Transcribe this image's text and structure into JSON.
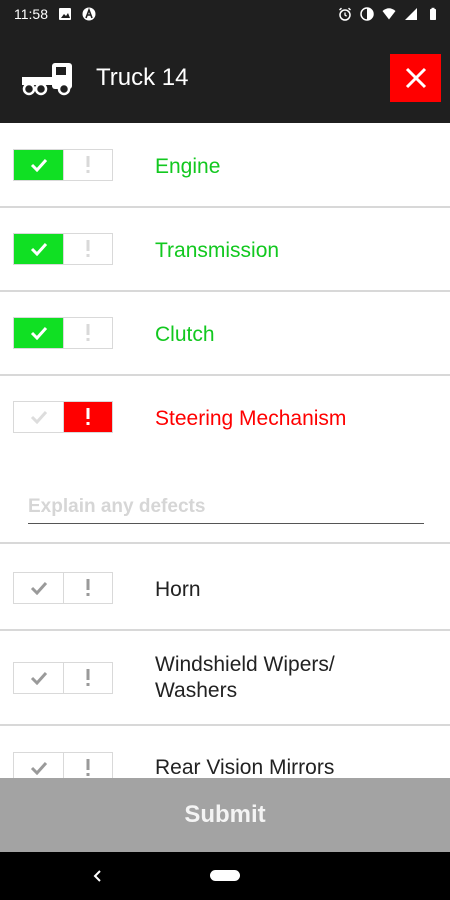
{
  "status_bar": {
    "time": "11:58",
    "left_icons": [
      "image-icon",
      "app-a-icon"
    ],
    "right_icons": [
      "alarm-icon",
      "data-saver-icon",
      "wifi-icon",
      "signal-icon",
      "battery-icon"
    ]
  },
  "header": {
    "title": "Truck 14",
    "icon": "truck-icon",
    "close_icon": "close-icon"
  },
  "colors": {
    "ok": "#10e023",
    "ok_text": "#12c81f",
    "defect": "#ff0000",
    "app_bar": "#1f1f1f",
    "submit_bg": "#a3a3a3"
  },
  "items": [
    {
      "label": "Engine",
      "status": "ok"
    },
    {
      "label": "Transmission",
      "status": "ok"
    },
    {
      "label": "Clutch",
      "status": "ok"
    },
    {
      "label": "Steering Mechanism",
      "status": "defect"
    },
    {
      "label": "Horn",
      "status": "none"
    },
    {
      "label": "Windshield Wipers/ Washers",
      "label_line1": "Windshield Wipers/",
      "label_line2": "Washers",
      "status": "none"
    },
    {
      "label": "Rear Vision Mirrors",
      "status": "none"
    }
  ],
  "defect_input": {
    "placeholder": "Explain any defects",
    "value": ""
  },
  "submit": {
    "label": "Submit"
  },
  "nav": {
    "back_icon": "back-icon",
    "home_icon": "home-pill-icon"
  }
}
